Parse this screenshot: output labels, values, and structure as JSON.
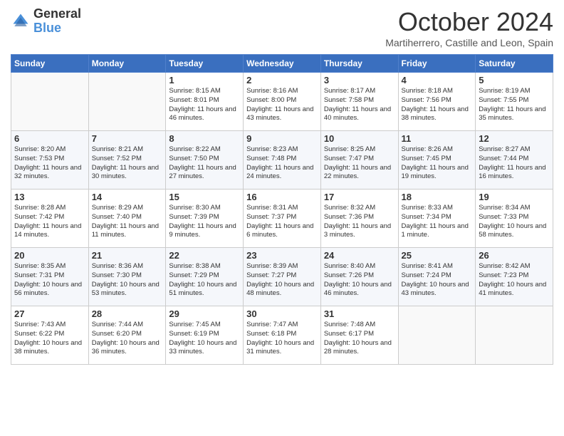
{
  "logo": {
    "general": "General",
    "blue": "Blue"
  },
  "header": {
    "month": "October 2024",
    "location": "Martiherrero, Castille and Leon, Spain"
  },
  "weekdays": [
    "Sunday",
    "Monday",
    "Tuesday",
    "Wednesday",
    "Thursday",
    "Friday",
    "Saturday"
  ],
  "weeks": [
    [
      {
        "day": "",
        "sunrise": "",
        "sunset": "",
        "daylight": ""
      },
      {
        "day": "",
        "sunrise": "",
        "sunset": "",
        "daylight": ""
      },
      {
        "day": "1",
        "sunrise": "Sunrise: 8:15 AM",
        "sunset": "Sunset: 8:01 PM",
        "daylight": "Daylight: 11 hours and 46 minutes."
      },
      {
        "day": "2",
        "sunrise": "Sunrise: 8:16 AM",
        "sunset": "Sunset: 8:00 PM",
        "daylight": "Daylight: 11 hours and 43 minutes."
      },
      {
        "day": "3",
        "sunrise": "Sunrise: 8:17 AM",
        "sunset": "Sunset: 7:58 PM",
        "daylight": "Daylight: 11 hours and 40 minutes."
      },
      {
        "day": "4",
        "sunrise": "Sunrise: 8:18 AM",
        "sunset": "Sunset: 7:56 PM",
        "daylight": "Daylight: 11 hours and 38 minutes."
      },
      {
        "day": "5",
        "sunrise": "Sunrise: 8:19 AM",
        "sunset": "Sunset: 7:55 PM",
        "daylight": "Daylight: 11 hours and 35 minutes."
      }
    ],
    [
      {
        "day": "6",
        "sunrise": "Sunrise: 8:20 AM",
        "sunset": "Sunset: 7:53 PM",
        "daylight": "Daylight: 11 hours and 32 minutes."
      },
      {
        "day": "7",
        "sunrise": "Sunrise: 8:21 AM",
        "sunset": "Sunset: 7:52 PM",
        "daylight": "Daylight: 11 hours and 30 minutes."
      },
      {
        "day": "8",
        "sunrise": "Sunrise: 8:22 AM",
        "sunset": "Sunset: 7:50 PM",
        "daylight": "Daylight: 11 hours and 27 minutes."
      },
      {
        "day": "9",
        "sunrise": "Sunrise: 8:23 AM",
        "sunset": "Sunset: 7:48 PM",
        "daylight": "Daylight: 11 hours and 24 minutes."
      },
      {
        "day": "10",
        "sunrise": "Sunrise: 8:25 AM",
        "sunset": "Sunset: 7:47 PM",
        "daylight": "Daylight: 11 hours and 22 minutes."
      },
      {
        "day": "11",
        "sunrise": "Sunrise: 8:26 AM",
        "sunset": "Sunset: 7:45 PM",
        "daylight": "Daylight: 11 hours and 19 minutes."
      },
      {
        "day": "12",
        "sunrise": "Sunrise: 8:27 AM",
        "sunset": "Sunset: 7:44 PM",
        "daylight": "Daylight: 11 hours and 16 minutes."
      }
    ],
    [
      {
        "day": "13",
        "sunrise": "Sunrise: 8:28 AM",
        "sunset": "Sunset: 7:42 PM",
        "daylight": "Daylight: 11 hours and 14 minutes."
      },
      {
        "day": "14",
        "sunrise": "Sunrise: 8:29 AM",
        "sunset": "Sunset: 7:40 PM",
        "daylight": "Daylight: 11 hours and 11 minutes."
      },
      {
        "day": "15",
        "sunrise": "Sunrise: 8:30 AM",
        "sunset": "Sunset: 7:39 PM",
        "daylight": "Daylight: 11 hours and 9 minutes."
      },
      {
        "day": "16",
        "sunrise": "Sunrise: 8:31 AM",
        "sunset": "Sunset: 7:37 PM",
        "daylight": "Daylight: 11 hours and 6 minutes."
      },
      {
        "day": "17",
        "sunrise": "Sunrise: 8:32 AM",
        "sunset": "Sunset: 7:36 PM",
        "daylight": "Daylight: 11 hours and 3 minutes."
      },
      {
        "day": "18",
        "sunrise": "Sunrise: 8:33 AM",
        "sunset": "Sunset: 7:34 PM",
        "daylight": "Daylight: 11 hours and 1 minute."
      },
      {
        "day": "19",
        "sunrise": "Sunrise: 8:34 AM",
        "sunset": "Sunset: 7:33 PM",
        "daylight": "Daylight: 10 hours and 58 minutes."
      }
    ],
    [
      {
        "day": "20",
        "sunrise": "Sunrise: 8:35 AM",
        "sunset": "Sunset: 7:31 PM",
        "daylight": "Daylight: 10 hours and 56 minutes."
      },
      {
        "day": "21",
        "sunrise": "Sunrise: 8:36 AM",
        "sunset": "Sunset: 7:30 PM",
        "daylight": "Daylight: 10 hours and 53 minutes."
      },
      {
        "day": "22",
        "sunrise": "Sunrise: 8:38 AM",
        "sunset": "Sunset: 7:29 PM",
        "daylight": "Daylight: 10 hours and 51 minutes."
      },
      {
        "day": "23",
        "sunrise": "Sunrise: 8:39 AM",
        "sunset": "Sunset: 7:27 PM",
        "daylight": "Daylight: 10 hours and 48 minutes."
      },
      {
        "day": "24",
        "sunrise": "Sunrise: 8:40 AM",
        "sunset": "Sunset: 7:26 PM",
        "daylight": "Daylight: 10 hours and 46 minutes."
      },
      {
        "day": "25",
        "sunrise": "Sunrise: 8:41 AM",
        "sunset": "Sunset: 7:24 PM",
        "daylight": "Daylight: 10 hours and 43 minutes."
      },
      {
        "day": "26",
        "sunrise": "Sunrise: 8:42 AM",
        "sunset": "Sunset: 7:23 PM",
        "daylight": "Daylight: 10 hours and 41 minutes."
      }
    ],
    [
      {
        "day": "27",
        "sunrise": "Sunrise: 7:43 AM",
        "sunset": "Sunset: 6:22 PM",
        "daylight": "Daylight: 10 hours and 38 minutes."
      },
      {
        "day": "28",
        "sunrise": "Sunrise: 7:44 AM",
        "sunset": "Sunset: 6:20 PM",
        "daylight": "Daylight: 10 hours and 36 minutes."
      },
      {
        "day": "29",
        "sunrise": "Sunrise: 7:45 AM",
        "sunset": "Sunset: 6:19 PM",
        "daylight": "Daylight: 10 hours and 33 minutes."
      },
      {
        "day": "30",
        "sunrise": "Sunrise: 7:47 AM",
        "sunset": "Sunset: 6:18 PM",
        "daylight": "Daylight: 10 hours and 31 minutes."
      },
      {
        "day": "31",
        "sunrise": "Sunrise: 7:48 AM",
        "sunset": "Sunset: 6:17 PM",
        "daylight": "Daylight: 10 hours and 28 minutes."
      },
      {
        "day": "",
        "sunrise": "",
        "sunset": "",
        "daylight": ""
      },
      {
        "day": "",
        "sunrise": "",
        "sunset": "",
        "daylight": ""
      }
    ]
  ]
}
